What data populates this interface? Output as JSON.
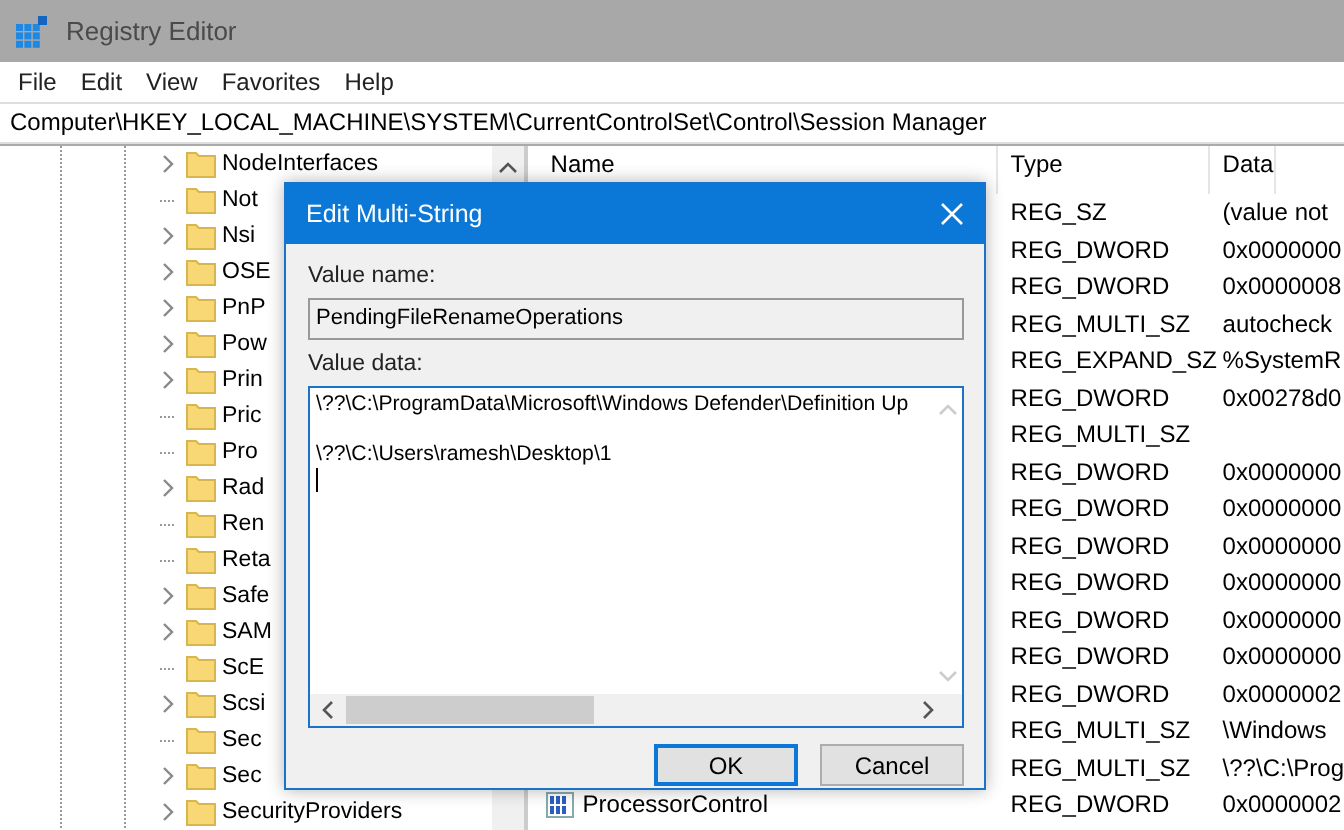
{
  "window": {
    "title": "Registry Editor"
  },
  "menu": [
    "File",
    "Edit",
    "View",
    "Favorites",
    "Help"
  ],
  "address": "Computer\\HKEY_LOCAL_MACHINE\\SYSTEM\\CurrentControlSet\\Control\\Session Manager",
  "tree": {
    "items": [
      {
        "label": "NodeInterfaces",
        "expandable": true
      },
      {
        "label": "Not",
        "expandable": false
      },
      {
        "label": "Nsi",
        "expandable": true
      },
      {
        "label": "OSE",
        "expandable": true
      },
      {
        "label": "PnP",
        "expandable": true
      },
      {
        "label": "Pow",
        "expandable": true
      },
      {
        "label": "Prin",
        "expandable": true
      },
      {
        "label": "Pric",
        "expandable": false
      },
      {
        "label": "Pro",
        "expandable": false
      },
      {
        "label": "Rad",
        "expandable": true
      },
      {
        "label": "Ren",
        "expandable": false
      },
      {
        "label": "Reta",
        "expandable": false
      },
      {
        "label": "Safe",
        "expandable": true
      },
      {
        "label": "SAM",
        "expandable": true
      },
      {
        "label": "ScE",
        "expandable": false
      },
      {
        "label": "Scsi",
        "expandable": true
      },
      {
        "label": "Sec",
        "expandable": false
      },
      {
        "label": "Sec",
        "expandable": true
      },
      {
        "label": "SecurityProviders",
        "expandable": true
      }
    ]
  },
  "list": {
    "columns": [
      "Name",
      "Type",
      "Data"
    ],
    "rows": [
      {
        "type": "REG_SZ",
        "data": "(value not"
      },
      {
        "type": "REG_DWORD",
        "data": "0x0000000"
      },
      {
        "type": "REG_DWORD",
        "data": "0x0000008"
      },
      {
        "type": "REG_MULTI_SZ",
        "data": "autocheck"
      },
      {
        "type": "REG_EXPAND_SZ",
        "data": "%SystemR"
      },
      {
        "type": "REG_DWORD",
        "data": "0x00278d0"
      },
      {
        "type": "REG_MULTI_SZ"
      },
      {
        "type": "REG_DWORD",
        "data": "0x0000000"
      },
      {
        "type": "REG_DWORD",
        "data": "0x0000000"
      },
      {
        "type": "REG_DWORD",
        "data": "0x0000000"
      },
      {
        "type": "REG_DWORD",
        "data": "0x0000000"
      },
      {
        "type": "REG_DWORD",
        "data": "0x0000000"
      },
      {
        "type": "REG_DWORD",
        "data": "0x0000000"
      },
      {
        "type": "REG_DWORD",
        "data": "0x0000002"
      },
      {
        "type": "REG_MULTI_SZ",
        "data": "\\Windows"
      },
      {
        "type": "REG_MULTI_SZ",
        "data": "\\??\\C:\\Prog"
      },
      {
        "name": "ProcessorControl",
        "type": "REG_DWORD",
        "data": "0x0000002"
      }
    ]
  },
  "dialog": {
    "title": "Edit Multi-String",
    "value_name_label": "Value name:",
    "value_name": "PendingFileRenameOperations",
    "value_data_label": "Value data:",
    "value_data": [
      "\\??\\C:\\ProgramData\\Microsoft\\Windows Defender\\Definition Up",
      "\\??\\C:\\Users\\ramesh\\Desktop\\1"
    ],
    "buttons": [
      {
        "label": "OK",
        "default": true
      },
      {
        "label": "Cancel",
        "default": false
      }
    ]
  }
}
